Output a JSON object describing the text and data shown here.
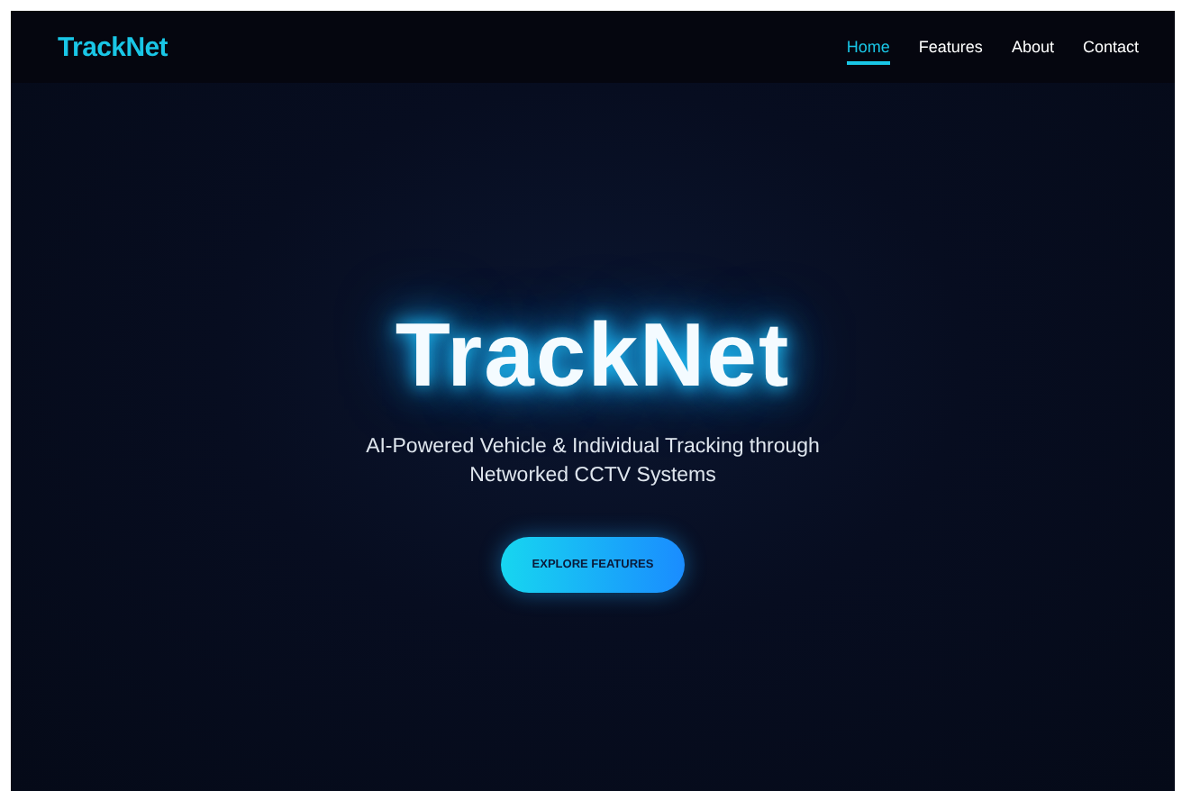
{
  "navbar": {
    "brand": "TrackNet",
    "links": [
      {
        "label": "Home",
        "selected": true
      },
      {
        "label": "Features",
        "selected": false
      },
      {
        "label": "About",
        "selected": false
      },
      {
        "label": "Contact",
        "selected": false
      }
    ]
  },
  "hero": {
    "title": "TrackNet",
    "subtitle": "AI-Powered Vehicle & Individual Tracking through Networked CCTV Systems",
    "button": "EXPLORE FEATURES"
  }
}
